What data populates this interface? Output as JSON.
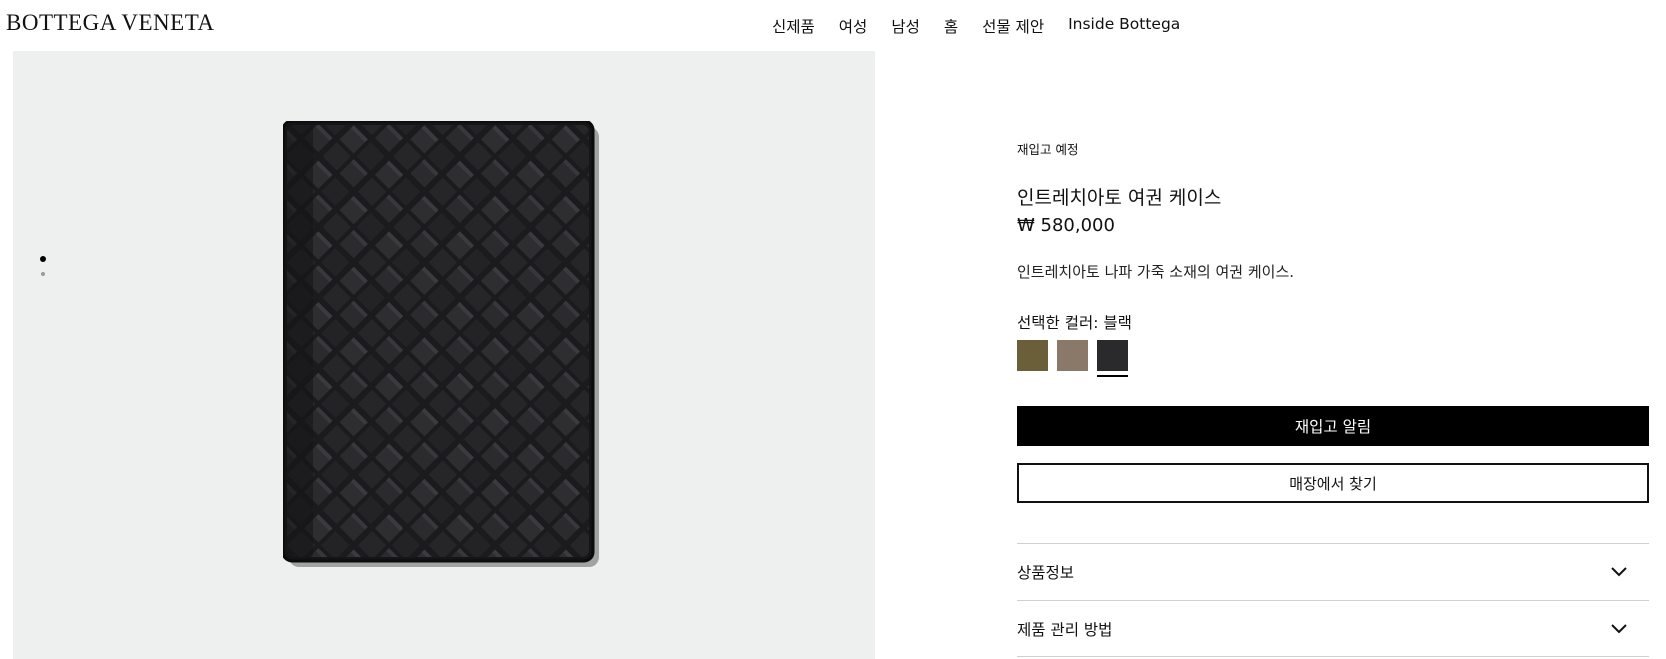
{
  "header": {
    "logo": "BOTTEGA VENETA",
    "nav": [
      "신제품",
      "여성",
      "남성",
      "홈",
      "선물 제안",
      "Inside Bottega"
    ]
  },
  "gallery": {
    "image_count": 2,
    "active_index": 0,
    "background": "#eef0ef",
    "product_color": "#1c1c1e"
  },
  "product": {
    "restock_note": "재입고 예정",
    "title": "인트레치아토 여권 케이스",
    "price": "₩ 580,000",
    "description": "인트레치아토 나파 가죽 소재의 여권 케이스.",
    "color_label": "선택한 컬러: 블랙",
    "swatches": [
      {
        "name": "olive",
        "color": "#6b5f3a",
        "selected": false
      },
      {
        "name": "taupe",
        "color": "#8a7868",
        "selected": false
      },
      {
        "name": "black",
        "color": "#2a2a2c",
        "selected": true
      }
    ],
    "notify_button": "재입고 알림",
    "store_button": "매장에서 찾기",
    "accordion": [
      "상품정보",
      "제품 관리 방법"
    ]
  }
}
